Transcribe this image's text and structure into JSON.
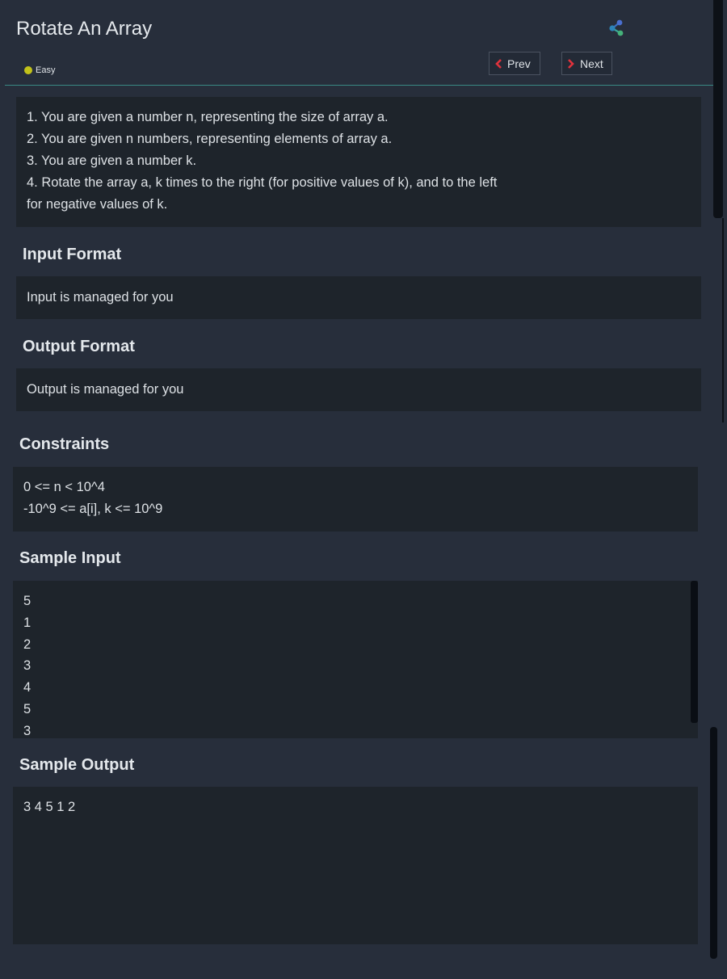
{
  "problem": {
    "title": "Rotate An Array",
    "difficulty": "Easy",
    "difficulty_color": "#c2c21a"
  },
  "nav": {
    "prev_label": "Prev",
    "next_label": "Next",
    "share_icon": "share-icon",
    "chevron_color": "#e0323c"
  },
  "description": {
    "lines": [
      "1. You are given a number n, representing the size of array a.",
      "2. You are given n numbers, representing elements of array a.",
      "3. You are given a number k.",
      "4. Rotate the array a, k times to the right (for positive values of k), and to the left for negative values of k."
    ]
  },
  "input_format": {
    "heading": "Input Format",
    "text": "Input is managed for you"
  },
  "output_format": {
    "heading": "Output Format",
    "text": "Output is managed for you"
  },
  "constraints": {
    "heading": "Constraints",
    "lines": [
      "0 <= n < 10^4",
      "-10^9 <= a[i], k <= 10^9"
    ]
  },
  "sample_input": {
    "heading": "Sample Input",
    "lines": [
      "5",
      "1",
      "2",
      "3",
      "4",
      "5",
      "3"
    ]
  },
  "sample_output": {
    "heading": "Sample Output",
    "text": "3 4 5 1 2"
  }
}
